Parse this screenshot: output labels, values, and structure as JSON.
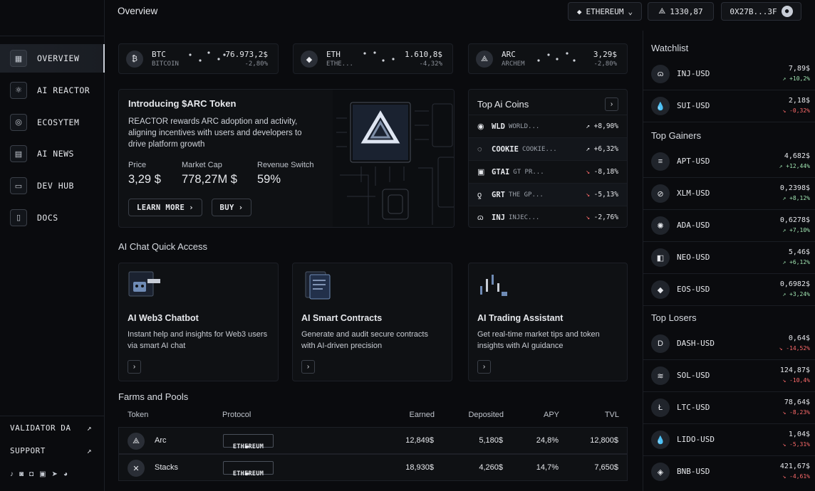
{
  "header": {
    "title": "Overview",
    "network": "ETHEREUM",
    "balance": "1330,87",
    "wallet": "0X27B...3F"
  },
  "sidebar": {
    "items": [
      {
        "label": "OVERVIEW",
        "icon": "grid-icon"
      },
      {
        "label": "AI REACTOR",
        "icon": "reactor-icon"
      },
      {
        "label": "ECOSYTEM",
        "icon": "globe-icon"
      },
      {
        "label": "AI NEWS",
        "icon": "news-icon"
      },
      {
        "label": "DEV HUB",
        "icon": "monitor-icon"
      },
      {
        "label": "DOCS",
        "icon": "document-icon"
      }
    ],
    "links": [
      {
        "label": "VALIDATOR DA"
      },
      {
        "label": "SUPPORT"
      }
    ],
    "socials": [
      "tiktok-icon",
      "discord-icon",
      "instagram-icon",
      "linkedin-icon",
      "telegram-icon",
      "medium-icon"
    ]
  },
  "tickers": [
    {
      "symbol": "BTC",
      "name": "BITCOIN",
      "price": "76.973,2$",
      "change": "-2,80%"
    },
    {
      "symbol": "ETH",
      "name": "ETHE...",
      "price": "1.610,8$",
      "change": "-4,32%"
    },
    {
      "symbol": "ARC",
      "name": "ARCHEM",
      "price": "3,29$",
      "change": "-2,80%"
    }
  ],
  "promo": {
    "title": "Introducing $ARC Token",
    "description": "REACTOR rewards ARC adoption and activity, aligning incentives with users and developers to drive platform growth",
    "stats": [
      {
        "label": "Price",
        "value": "3,29 $"
      },
      {
        "label": "Market Cap",
        "value": "778,27M $"
      },
      {
        "label": "Revenue Switch",
        "value": "59%"
      }
    ],
    "learn_more": "LEARN MORE",
    "buy": "BUY"
  },
  "top_ai_coins": {
    "title": "Top Ai Coins",
    "rows": [
      {
        "symbol": "WLD",
        "name": "WORLD...",
        "change": "+8,90%",
        "dir": "up"
      },
      {
        "symbol": "COOKIE",
        "name": "COOKIE...",
        "change": "+6,32%",
        "dir": "up"
      },
      {
        "symbol": "GTAI",
        "name": "GT PR...",
        "change": "-8,18%",
        "dir": "down"
      },
      {
        "symbol": "GRT",
        "name": "THE GP...",
        "change": "-5,13%",
        "dir": "down"
      },
      {
        "symbol": "INJ",
        "name": "INJEC...",
        "change": "-2,76%",
        "dir": "down"
      }
    ]
  },
  "chat": {
    "title": "AI Chat Quick Access",
    "cards": [
      {
        "title": "AI Web3 Chatbot",
        "desc": "Instant help and insights for Web3 users via smart AI chat"
      },
      {
        "title": "AI Smart Contracts",
        "desc": "Generate and audit secure contracts with AI-driven precision"
      },
      {
        "title": "AI Trading Assistant",
        "desc": "Get real-time market tips and token insights with AI guidance"
      }
    ]
  },
  "farms": {
    "title": "Farms and Pools",
    "headers": [
      "Token",
      "Protocol",
      "Earned",
      "Deposited",
      "APY",
      "TVL"
    ],
    "rows": [
      {
        "token": "Arc",
        "protocol": "ETHEREUM",
        "earned": "12,849$",
        "deposited": "5,180$",
        "apy": "24,8%",
        "tvl": "12,800$"
      },
      {
        "token": "Stacks",
        "protocol": "ETHEREUM",
        "earned": "18,930$",
        "deposited": "4,260$",
        "apy": "14,7%",
        "tvl": "7,650$"
      }
    ]
  },
  "watchlist": {
    "title": "Watchlist",
    "rows": [
      {
        "symbol": "INJ-USD",
        "price": "7,89$",
        "change": "+10,2%",
        "dir": "up"
      },
      {
        "symbol": "SUI-USD",
        "price": "2,18$",
        "change": "-0,32%",
        "dir": "down"
      }
    ]
  },
  "gainers": {
    "title": "Top Gainers",
    "rows": [
      {
        "symbol": "APT-USD",
        "price": "4,682$",
        "change": "+12,44%",
        "dir": "up"
      },
      {
        "symbol": "XLM-USD",
        "price": "0,2398$",
        "change": "+8,12%",
        "dir": "up"
      },
      {
        "symbol": "ADA-USD",
        "price": "0,6278$",
        "change": "+7,10%",
        "dir": "up"
      },
      {
        "symbol": "NEO-USD",
        "price": "5,46$",
        "change": "+6,12%",
        "dir": "up"
      },
      {
        "symbol": "EOS-USD",
        "price": "0,6982$",
        "change": "+3,24%",
        "dir": "up"
      }
    ]
  },
  "losers": {
    "title": "Top Losers",
    "rows": [
      {
        "symbol": "DASH-USD",
        "price": "0,64$",
        "change": "-14,52%",
        "dir": "down"
      },
      {
        "symbol": "SOL-USD",
        "price": "124,87$",
        "change": "-10,4%",
        "dir": "down"
      },
      {
        "symbol": "LTC-USD",
        "price": "78,64$",
        "change": "-8,23%",
        "dir": "down"
      },
      {
        "symbol": "LIDO-USD",
        "price": "1,04$",
        "change": "-5,31%",
        "dir": "down"
      },
      {
        "symbol": "BNB-USD",
        "price": "421,67$",
        "change": "-4,61%",
        "dir": "down"
      }
    ]
  }
}
